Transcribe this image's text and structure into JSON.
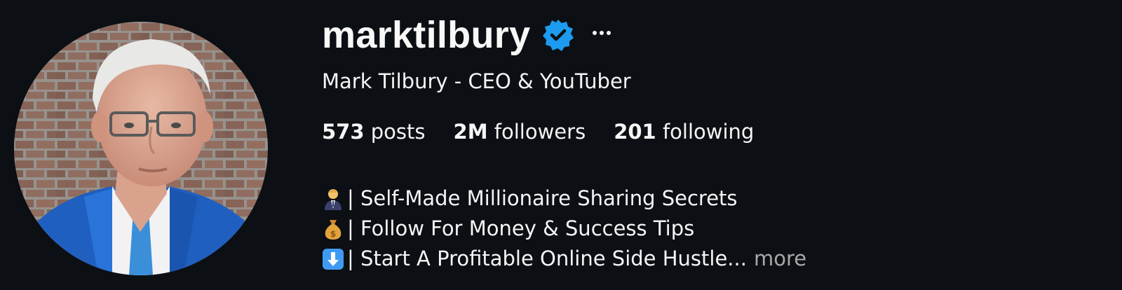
{
  "profile": {
    "username": "marktilbury",
    "full_name": "Mark Tilbury - CEO & YouTuber",
    "verified_icon": "verified-badge-icon",
    "more_icon": "more-options-icon",
    "accent_color": "#0095f6",
    "stats": {
      "posts_count": "573",
      "posts_label": "posts",
      "followers_count": "2M",
      "followers_label": "followers",
      "following_count": "201",
      "following_label": "following"
    },
    "bio": [
      {
        "icon": "businessman-emoji-icon",
        "text": "| Self-Made Millionaire Sharing Secrets"
      },
      {
        "icon": "money-bag-emoji-icon",
        "text": "| Follow For Money & Success Tips"
      },
      {
        "icon": "down-arrow-emoji-icon",
        "text": "| Start A Profitable Online Side Hustle..."
      }
    ],
    "more_label": "more"
  }
}
